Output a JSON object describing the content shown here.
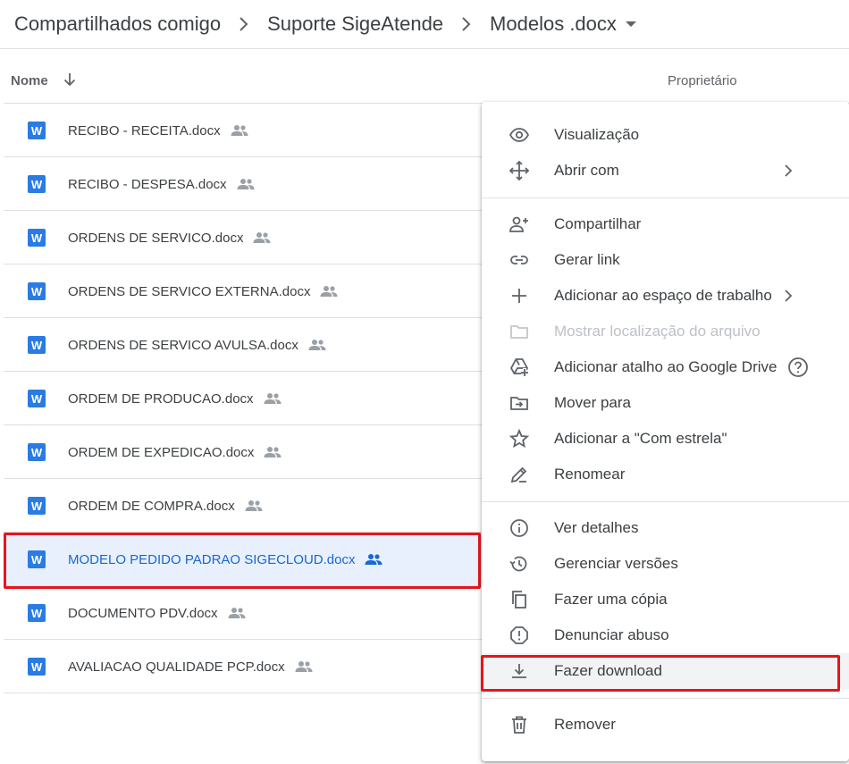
{
  "breadcrumb": {
    "items": [
      "Compartilhados comigo",
      "Suporte SigeAtende",
      "Modelos .docx"
    ]
  },
  "columns": {
    "name": "Nome",
    "owner": "Proprietário"
  },
  "files": [
    {
      "name": "RECIBO - RECEITA.docx",
      "icon": "W"
    },
    {
      "name": "RECIBO - DESPESA.docx",
      "icon": "W"
    },
    {
      "name": "ORDENS DE SERVICO.docx",
      "icon": "W"
    },
    {
      "name": "ORDENS DE SERVICO EXTERNA.docx",
      "icon": "W"
    },
    {
      "name": "ORDENS DE SERVICO AVULSA.docx",
      "icon": "W"
    },
    {
      "name": "ORDEM DE PRODUCAO.docx",
      "icon": "W"
    },
    {
      "name": "ORDEM DE EXPEDICAO.docx",
      "icon": "W"
    },
    {
      "name": "ORDEM DE COMPRA.docx",
      "icon": "W"
    },
    {
      "name": "MODELO PEDIDO PADRAO SIGECLOUD.docx",
      "icon": "W",
      "selected": true
    },
    {
      "name": "DOCUMENTO PDV.docx",
      "icon": "W"
    },
    {
      "name": "AVALIACAO QUALIDADE PCP.docx",
      "icon": "W"
    }
  ],
  "menu": {
    "items": [
      {
        "label": "Visualização",
        "icon": "eye-icon"
      },
      {
        "label": "Abrir com",
        "icon": "move-arrows-icon",
        "submenu": true
      },
      {
        "label": "Compartilhar",
        "icon": "person-add-icon"
      },
      {
        "label": "Gerar link",
        "icon": "link-icon"
      },
      {
        "label": "Adicionar ao espaço de trabalho",
        "icon": "plus-icon",
        "submenu": true
      },
      {
        "label": "Mostrar localização do arquivo",
        "icon": "folder-icon",
        "disabled": true
      },
      {
        "label": "Adicionar atalho ao Google Drive",
        "icon": "drive-shortcut-icon",
        "help": true
      },
      {
        "label": "Mover para",
        "icon": "move-to-folder-icon"
      },
      {
        "label": "Adicionar a \"Com estrela\"",
        "icon": "star-icon"
      },
      {
        "label": "Renomear",
        "icon": "pencil-icon"
      },
      {
        "label": "Ver detalhes",
        "icon": "info-icon"
      },
      {
        "label": "Gerenciar versões",
        "icon": "history-icon"
      },
      {
        "label": "Fazer uma cópia",
        "icon": "copy-icon"
      },
      {
        "label": "Denunciar abuso",
        "icon": "report-icon"
      },
      {
        "label": "Fazer download",
        "icon": "download-icon",
        "hovered": true
      },
      {
        "label": "Remover",
        "icon": "trash-icon"
      }
    ]
  },
  "colors": {
    "accent": "#1967d2",
    "selected_bg": "#e8f0fe",
    "highlight_box": "#e8141c",
    "word_icon": "#2a7be4"
  }
}
